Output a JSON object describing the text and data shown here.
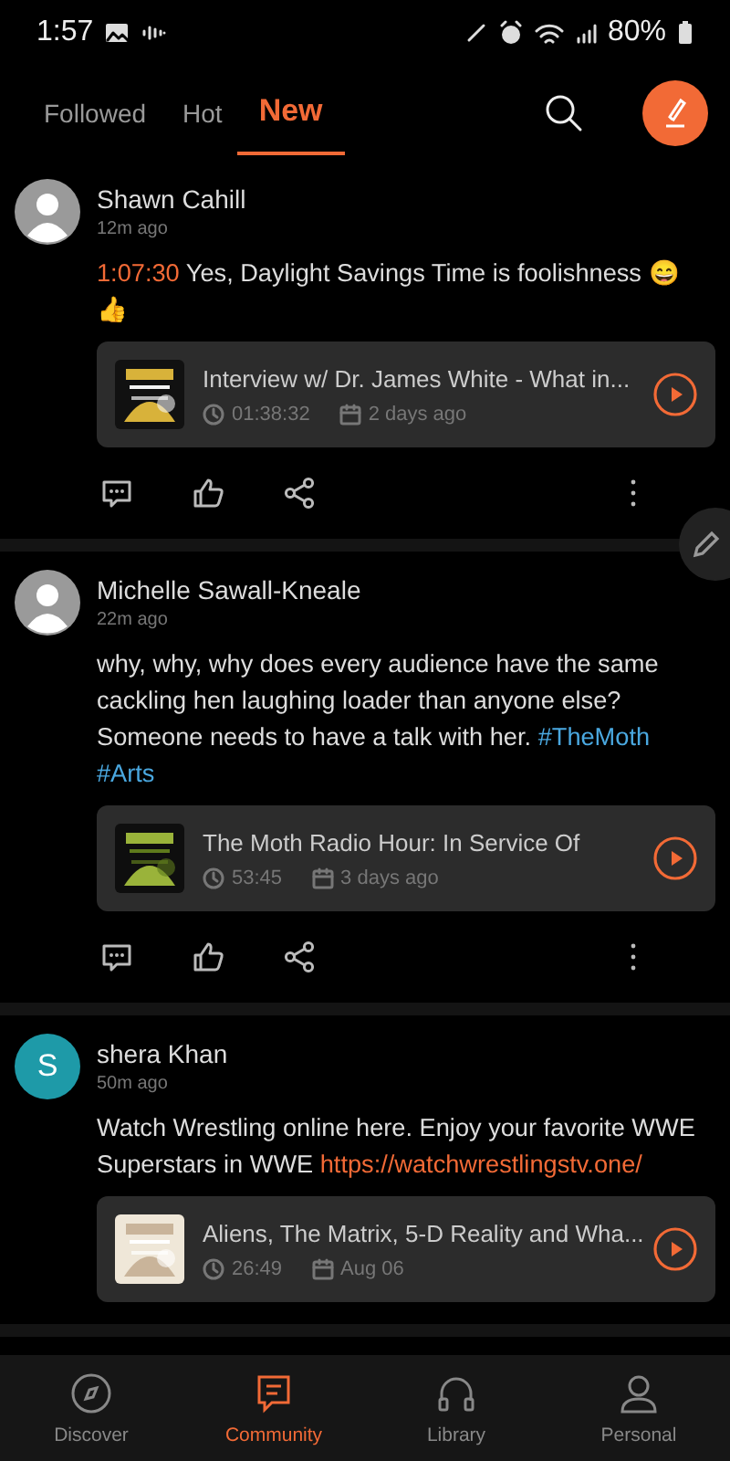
{
  "status_bar": {
    "time": "1:57",
    "battery": "80%"
  },
  "tabs": [
    {
      "label": "Followed",
      "selected": false
    },
    {
      "label": "Hot",
      "selected": false
    },
    {
      "label": "New",
      "selected": true
    }
  ],
  "posts": [
    {
      "author": "Shawn Cahill",
      "avatar": {
        "kind": "silhouette"
      },
      "time": "12m ago",
      "body": [
        {
          "kind": "timestamp",
          "text": "1:07:30"
        },
        {
          "kind": "text",
          "text": " Yes, Daylight Savings Time is foolishness 😄👍"
        }
      ],
      "episode": {
        "title": "Interview w/ Dr. James White - What in...",
        "duration": "01:38:32",
        "date": "2 days ago"
      }
    },
    {
      "author": "Michelle Sawall-Kneale",
      "avatar": {
        "kind": "silhouette"
      },
      "time": "22m ago",
      "body": [
        {
          "kind": "text",
          "text": "why, why, why does every audience have the same cackling hen laughing loader than anyone else? Someone needs to have a talk with her. "
        },
        {
          "kind": "hashtag",
          "text": "#TheMoth"
        },
        {
          "kind": "hashtag",
          "text": "#Arts"
        }
      ],
      "episode": {
        "title": "The Moth Radio Hour: In Service Of",
        "duration": "53:45",
        "date": "3 days ago"
      }
    },
    {
      "author": "shera Khan",
      "avatar": {
        "kind": "letter",
        "letter": "S",
        "color": "#1e9aa8"
      },
      "time": "50m ago",
      "body": [
        {
          "kind": "text",
          "text": "Watch Wrestling online here. Enjoy your favorite WWE Superstars in WWE "
        },
        {
          "kind": "link",
          "text": "https://watchwrestlingstv.one/"
        }
      ],
      "episode": {
        "title": "Aliens, The Matrix, 5-D Reality and Wha...",
        "duration": "26:49",
        "date": "Aug 06"
      }
    }
  ],
  "nav": [
    {
      "label": "Discover",
      "selected": false
    },
    {
      "label": "Community",
      "selected": true
    },
    {
      "label": "Library",
      "selected": false
    },
    {
      "label": "Personal",
      "selected": false
    }
  ]
}
